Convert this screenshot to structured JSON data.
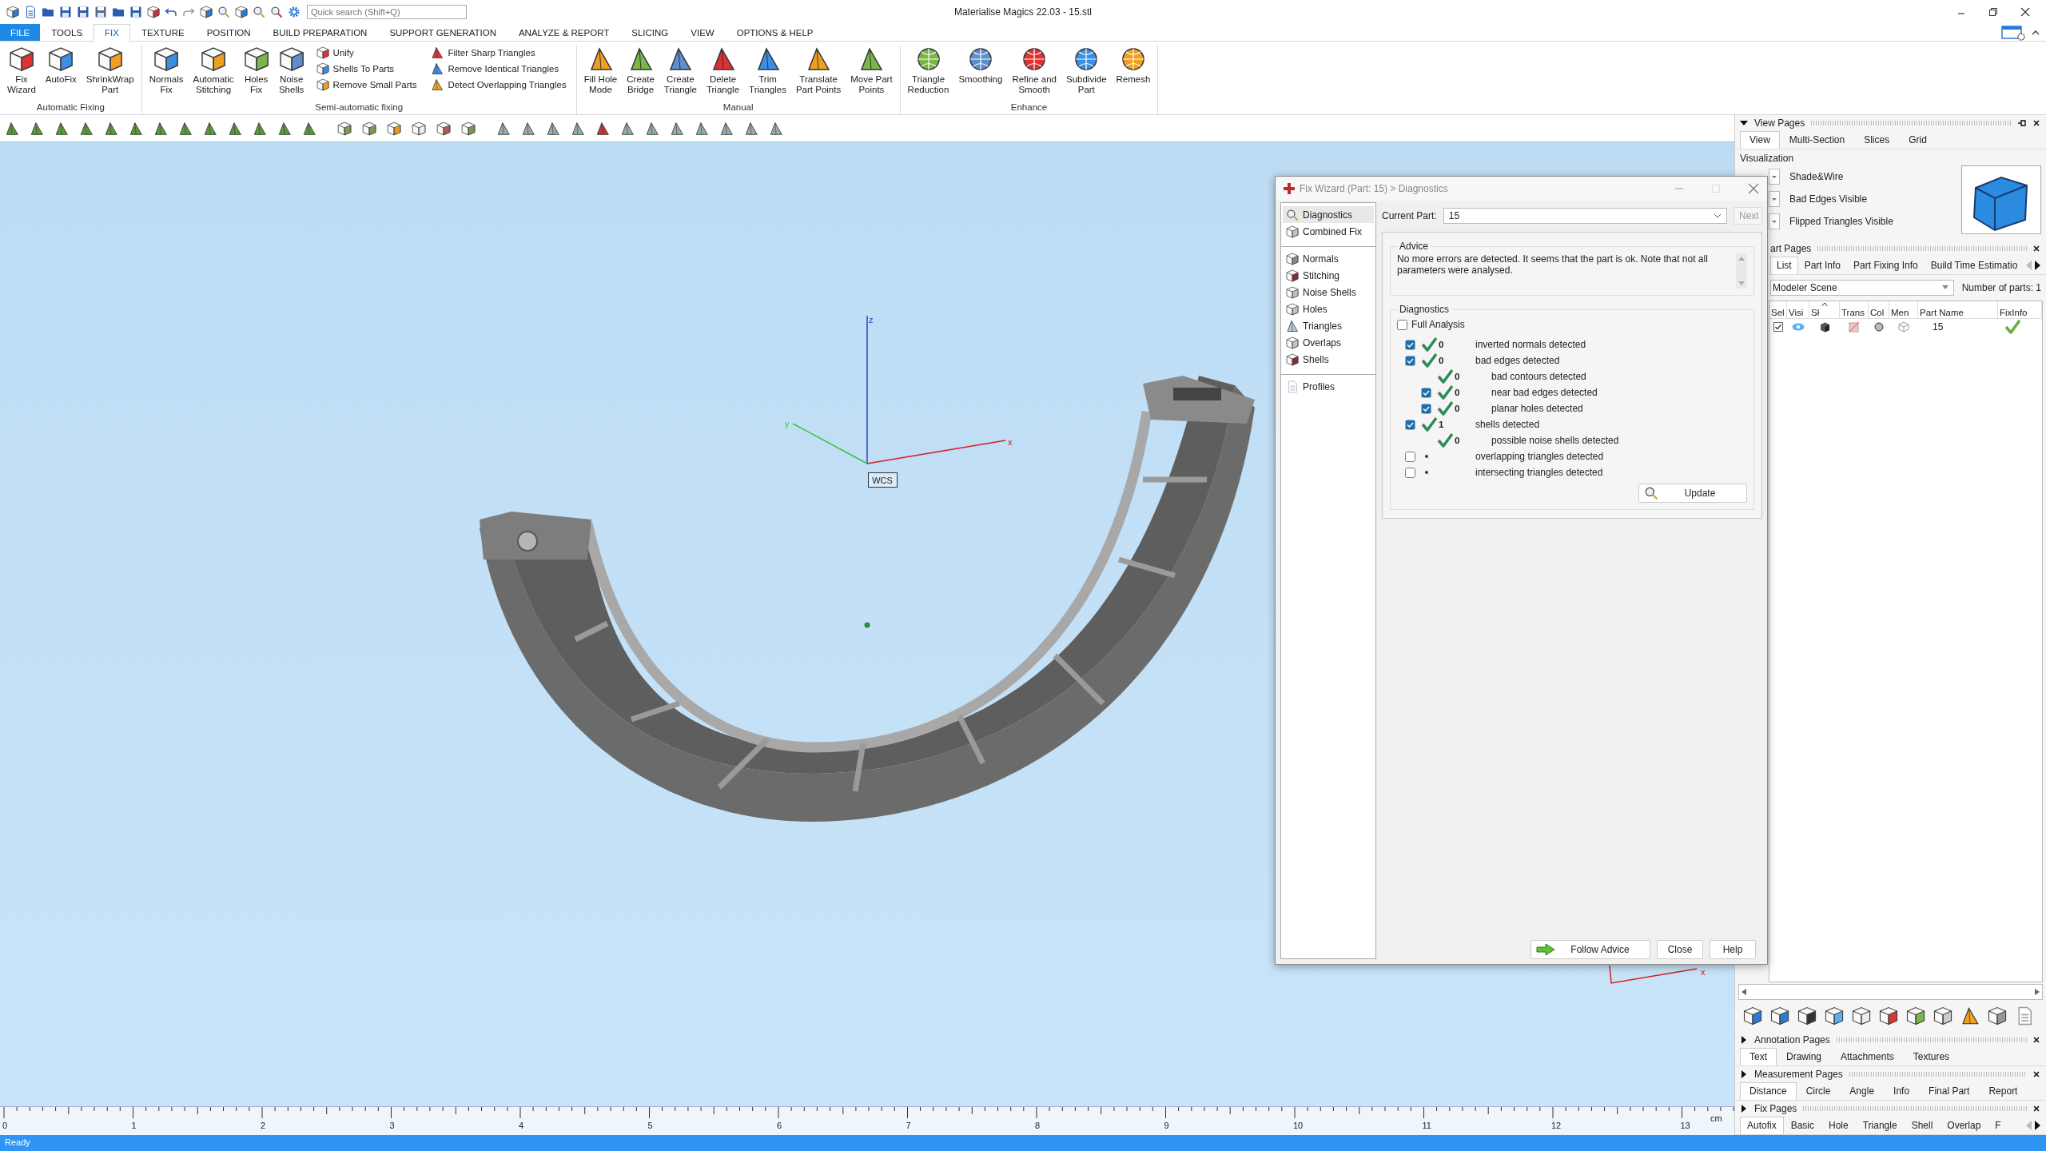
{
  "window": {
    "title": "Materialise Magics 22.03 - 15.stl"
  },
  "quick_search": {
    "placeholder": "Quick search (Shift+Q)"
  },
  "ribbon_tabs": [
    {
      "label": "FILE",
      "kind": "file",
      "selected": false
    },
    {
      "label": "TOOLS",
      "kind": "tab",
      "selected": false
    },
    {
      "label": "FIX",
      "kind": "tab",
      "selected": true
    },
    {
      "label": "TEXTURE",
      "kind": "tab",
      "selected": false
    },
    {
      "label": "POSITION",
      "kind": "tab",
      "selected": false
    },
    {
      "label": "BUILD PREPARATION",
      "kind": "tab",
      "selected": false
    },
    {
      "label": "SUPPORT GENERATION",
      "kind": "tab",
      "selected": false
    },
    {
      "label": "ANALYZE & REPORT",
      "kind": "tab",
      "selected": false
    },
    {
      "label": "SLICING",
      "kind": "tab",
      "selected": false
    },
    {
      "label": "VIEW",
      "kind": "tab",
      "selected": false
    },
    {
      "label": "OPTIONS & HELP",
      "kind": "tab",
      "selected": false
    }
  ],
  "ribbon_groups": [
    {
      "title": "Automatic Fixing",
      "items": [
        {
          "kind": "large",
          "label": "Fix\nWizard"
        },
        {
          "kind": "large",
          "label": "AutoFix"
        },
        {
          "kind": "large",
          "label": "ShrinkWrap\nPart"
        }
      ]
    },
    {
      "title": "Semi-automatic fixing",
      "items": [
        {
          "kind": "large",
          "label": "Normals\nFix"
        },
        {
          "kind": "large",
          "label": "Automatic\nStitching"
        },
        {
          "kind": "large",
          "label": "Holes\nFix"
        },
        {
          "kind": "large",
          "label": "Noise\nShells"
        },
        {
          "kind": "column",
          "items": [
            "Unify",
            "Shells To Parts",
            "Remove Small Parts"
          ]
        },
        {
          "kind": "column",
          "items": [
            "Filter Sharp Triangles",
            "Remove Identical Triangles",
            "Detect Overlapping Triangles"
          ]
        }
      ]
    },
    {
      "title": "Manual",
      "items": [
        {
          "kind": "large",
          "label": "Fill Hole\nMode"
        },
        {
          "kind": "large",
          "label": "Create\nBridge"
        },
        {
          "kind": "large",
          "label": "Create\nTriangle"
        },
        {
          "kind": "large",
          "label": "Delete\nTriangle"
        },
        {
          "kind": "large",
          "label": "Trim\nTriangles"
        },
        {
          "kind": "large",
          "label": "Translate\nPart Points"
        },
        {
          "kind": "large",
          "label": "Move Part\nPoints"
        }
      ]
    },
    {
      "title": "Enhance",
      "items": [
        {
          "kind": "large",
          "label": "Triangle\nReduction"
        },
        {
          "kind": "large",
          "label": "Smoothing"
        },
        {
          "kind": "large",
          "label": "Refine and\nSmooth"
        },
        {
          "kind": "large",
          "label": "Subdivide\nPart"
        },
        {
          "kind": "large",
          "label": "Remesh"
        }
      ]
    }
  ],
  "viewport": {
    "axes": [
      {
        "label": "z"
      },
      {
        "label": "y"
      },
      {
        "label": "x"
      }
    ],
    "origin_label": "WCS",
    "mini_axis_label": "x"
  },
  "ruler": {
    "ticks": [
      "0",
      "1",
      "2",
      "3",
      "4",
      "5",
      "6",
      "7",
      "8",
      "9",
      "10",
      "11",
      "12",
      "13"
    ],
    "unit": "cm"
  },
  "side_panel": {
    "view_pages": {
      "title": "View Pages",
      "expanded": true,
      "tabs": [
        {
          "label": "View",
          "selected": true
        },
        {
          "label": "Multi-Section",
          "selected": false
        },
        {
          "label": "Slices",
          "selected": false
        },
        {
          "label": "Grid",
          "selected": false
        }
      ],
      "group_title": "Visualization",
      "options": [
        "Shade&Wire",
        "Bad Edges Visible",
        "Flipped Triangles Visible"
      ]
    },
    "part_pages": {
      "title": "art Pages",
      "tabs": [
        {
          "label": "List",
          "selected": true
        },
        {
          "label": "Part Info",
          "selected": false
        },
        {
          "label": "Part Fixing Info",
          "selected": false
        },
        {
          "label": "Build Time Estimatio",
          "selected": false
        }
      ],
      "scene": "Modeler Scene",
      "parts_count": "Number of parts: 1",
      "columns": [
        {
          "label": "Sel",
          "sorted": false
        },
        {
          "label": "Visi",
          "sorted": false
        },
        {
          "label": "Sł",
          "sorted": true
        },
        {
          "label": "Trans",
          "sorted": false
        },
        {
          "label": "Col",
          "sorted": false
        },
        {
          "label": "Men",
          "sorted": false
        },
        {
          "label": "Part Name",
          "sorted": false
        },
        {
          "label": "FixInfo",
          "sorted": false
        }
      ],
      "rows": [
        {
          "checked": true,
          "visible": true,
          "name": "15",
          "fixed": true
        }
      ]
    },
    "annotation_pages": {
      "title": "Annotation Pages",
      "expanded": false,
      "tabs": [
        {
          "label": "Text",
          "selected": true
        },
        {
          "label": "Drawing",
          "selected": false
        },
        {
          "label": "Attachments",
          "selected": false
        },
        {
          "label": "Textures",
          "selected": false
        }
      ]
    },
    "measurement_pages": {
      "title": "Measurement Pages",
      "expanded": false,
      "tabs": [
        {
          "label": "Distance",
          "selected": true
        },
        {
          "label": "Circle",
          "selected": false
        },
        {
          "label": "Angle",
          "selected": false
        },
        {
          "label": "Info",
          "selected": false
        },
        {
          "label": "Final Part",
          "selected": false
        },
        {
          "label": "Report",
          "selected": false
        }
      ]
    },
    "fix_pages": {
      "title": "Fix Pages",
      "expanded": false,
      "tabs": [
        {
          "label": "Autofix",
          "selected": true
        },
        {
          "label": "Basic",
          "selected": false
        },
        {
          "label": "Hole",
          "selected": false
        },
        {
          "label": "Triangle",
          "selected": false
        },
        {
          "label": "Shell",
          "selected": false
        },
        {
          "label": "Overlap",
          "selected": false
        },
        {
          "label": "F",
          "selected": false
        }
      ]
    }
  },
  "fix_wizard": {
    "title": "Fix Wizard (Part: 15) > Diagnostics",
    "nav_groups": [
      {
        "items": [
          {
            "label": "Diagnostics",
            "selected": true
          },
          {
            "label": "Combined Fix",
            "selected": false
          }
        ]
      },
      {
        "items": [
          {
            "label": "Normals",
            "selected": false
          },
          {
            "label": "Stitching",
            "selected": false
          },
          {
            "label": "Noise Shells",
            "selected": false
          },
          {
            "label": "Holes",
            "selected": false
          },
          {
            "label": "Triangles",
            "selected": false
          },
          {
            "label": "Overlaps",
            "selected": false
          },
          {
            "label": "Shells",
            "selected": false
          }
        ]
      },
      {
        "items": [
          {
            "label": "Profiles",
            "selected": false
          }
        ]
      }
    ],
    "current_part": {
      "label": "Current Part:",
      "value": "15"
    },
    "next_button": {
      "label": "Next",
      "disabled": true
    },
    "advice": {
      "title": "Advice",
      "text": "No more errors are detected. It seems that the part is ok. Note that not all parameters were analysed."
    },
    "diagnostics": {
      "title": "Diagnostics",
      "full_analysis": {
        "label": "Full Analysis",
        "checked": false
      },
      "rows": [
        {
          "kind": "checkbox",
          "checked": true,
          "passed": true,
          "count": "0",
          "label": "inverted normals detected"
        },
        {
          "kind": "checkbox",
          "checked": true,
          "passed": true,
          "count": "0",
          "label": "bad edges detected",
          "children": [
            {
              "kind": "plain",
              "passed": true,
              "count": "0",
              "label": "bad contours detected"
            },
            {
              "kind": "checkbox",
              "checked": true,
              "passed": true,
              "count": "0",
              "label": "near bad edges detected"
            },
            {
              "kind": "checkbox",
              "checked": true,
              "passed": true,
              "count": "0",
              "label": "planar holes detected"
            }
          ]
        },
        {
          "kind": "checkbox",
          "checked": true,
          "passed": true,
          "count": "1",
          "label": "shells detected",
          "children": [
            {
              "kind": "plain",
              "passed": true,
              "count": "0",
              "label": "possible noise shells detected"
            }
          ]
        },
        {
          "kind": "checkbox",
          "checked": false,
          "passed": false,
          "label": "overlapping triangles detected"
        },
        {
          "kind": "checkbox",
          "checked": false,
          "passed": false,
          "label": "intersecting triangles detected"
        }
      ]
    },
    "update_button": "Update",
    "buttons": [
      "Follow Advice",
      "Close",
      "Help"
    ]
  },
  "status_bar": {
    "text": "Ready"
  }
}
